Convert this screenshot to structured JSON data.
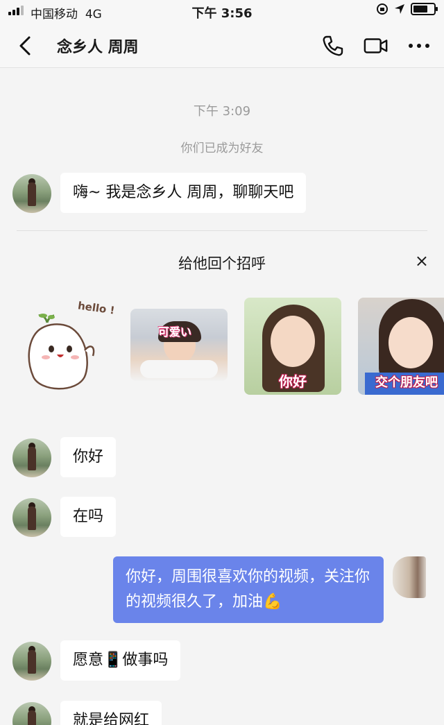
{
  "status_bar": {
    "carrier": "中国移动",
    "network": "4G",
    "time": "下午 3:56"
  },
  "nav": {
    "title": "念乡人 周周",
    "icons": [
      "back-arrow-icon",
      "phone-icon",
      "video-call-icon",
      "more-icon"
    ]
  },
  "chat": {
    "timestamp": "下午 3:09",
    "system_note": "你们已成为好友",
    "greeting_message": "嗨~ 我是念乡人 周周，聊聊天吧",
    "greet_panel": {
      "title": "给他回个招呼",
      "close": "×",
      "stickers": [
        {
          "caption": "hello !"
        },
        {
          "caption": "可爱い"
        },
        {
          "caption": "你好"
        },
        {
          "caption": "交个朋友吧"
        }
      ]
    },
    "messages": [
      {
        "side": "left",
        "text": "你好"
      },
      {
        "side": "left",
        "text": "在吗"
      },
      {
        "side": "right",
        "text": "你好，周围很喜欢你的视频，关注你的视频很久了，加油💪"
      },
      {
        "side": "left",
        "text": "愿意📱做事吗"
      },
      {
        "side": "left",
        "text": "就是给网红"
      }
    ]
  },
  "colors": {
    "background": "#f4f4f4",
    "my_bubble": "#6a84ea",
    "their_bubble": "#ffffff",
    "muted_text": "#9a9a9a"
  }
}
